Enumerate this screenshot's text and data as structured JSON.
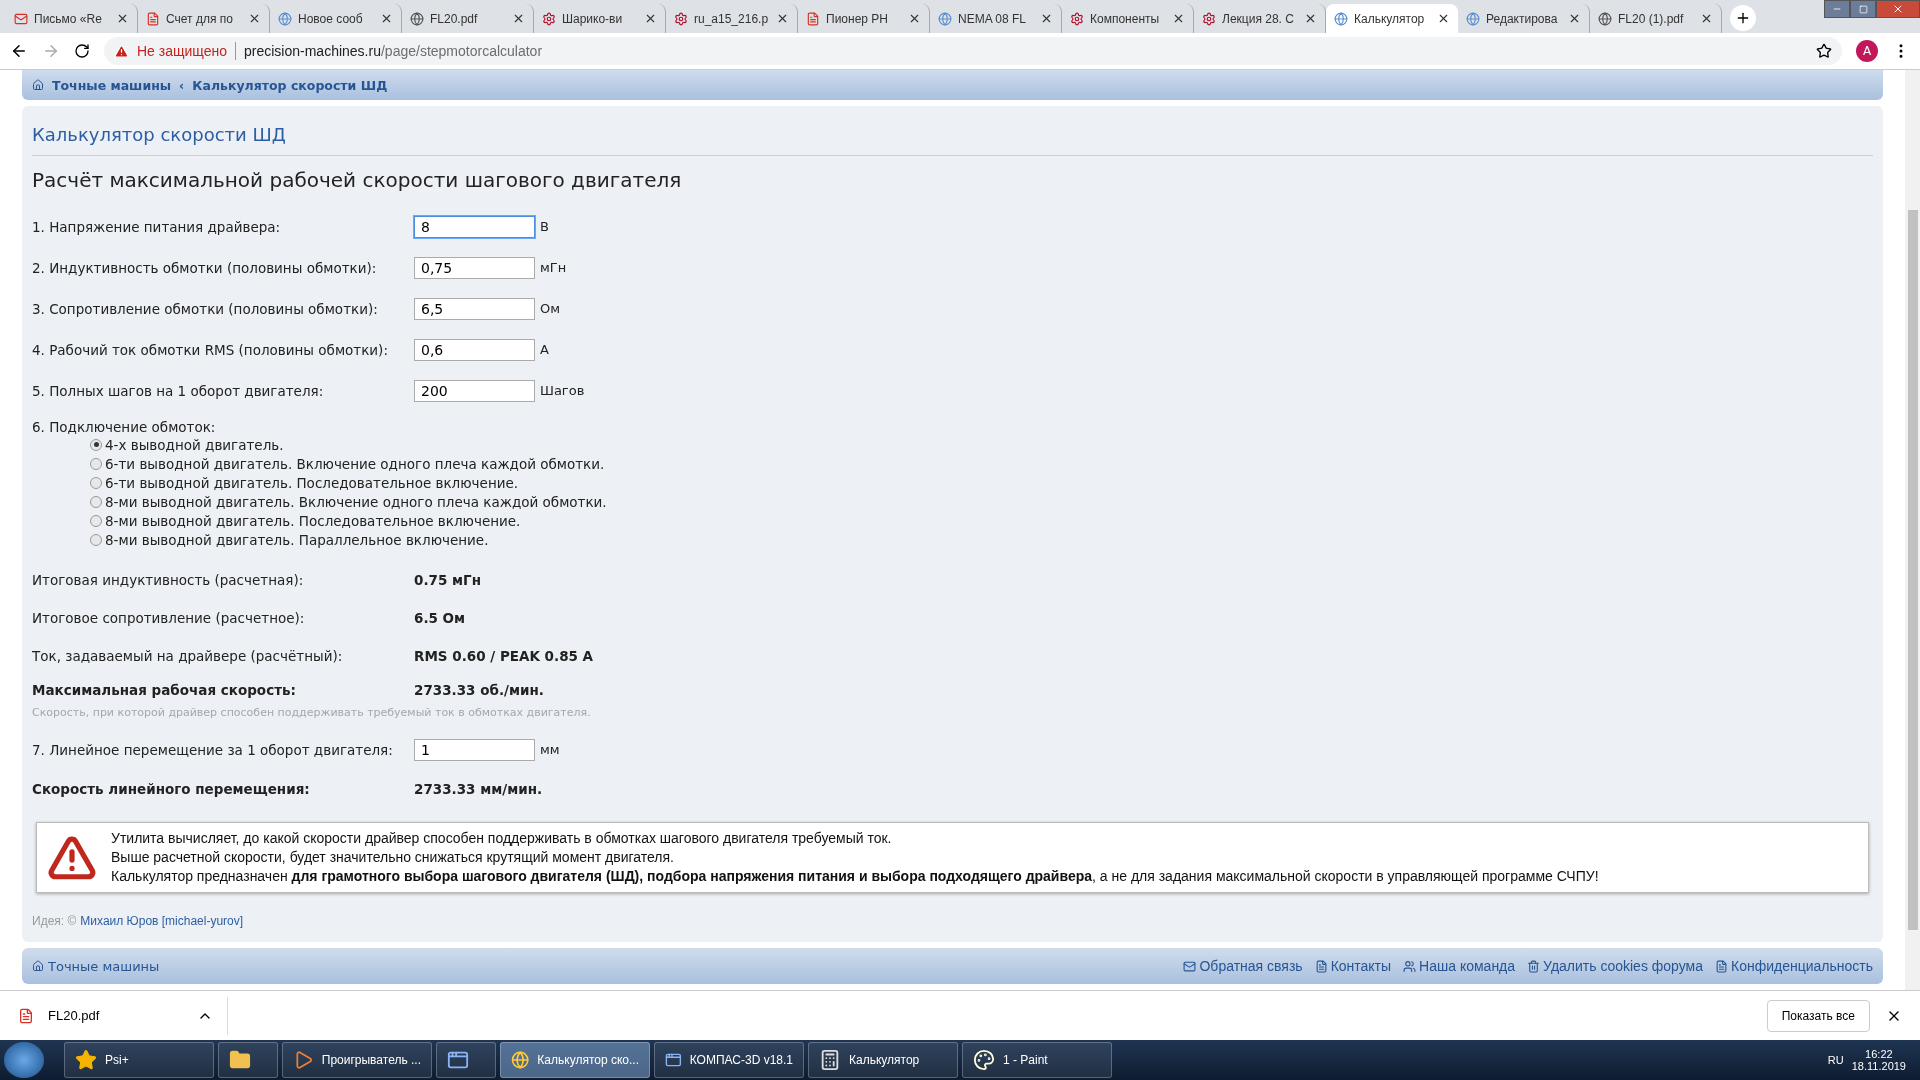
{
  "browser": {
    "tabs": [
      {
        "title": "Письмо «Re",
        "selected": false
      },
      {
        "title": "Счет для по",
        "selected": false
      },
      {
        "title": "Новое сооб",
        "selected": false
      },
      {
        "title": "FL20.pdf",
        "selected": false
      },
      {
        "title": "Шарико-ви",
        "selected": false
      },
      {
        "title": "ru_a15_216.p",
        "selected": false
      },
      {
        "title": "Пионер РН",
        "selected": false
      },
      {
        "title": "NEMA 08 FL",
        "selected": false
      },
      {
        "title": "Компоненты",
        "selected": false
      },
      {
        "title": "Лекция 28. С",
        "selected": false
      },
      {
        "title": "Калькулятор",
        "selected": true
      },
      {
        "title": "Редактирова",
        "selected": false
      },
      {
        "title": "FL20 (1).pdf",
        "selected": false
      }
    ],
    "security": "Не защищено",
    "host": "precision-machines.ru",
    "path": "/page/stepmotorcalculator",
    "profile": "A"
  },
  "breadcrumb": [
    "Точные машины",
    "Калькулятор скорости ШД"
  ],
  "breadcrumb_separator": "‹",
  "page_title": "Калькулятор скорости ШД",
  "heading": "Расчёт максимальной рабочей скорости шагового двигателя",
  "rows": [
    {
      "kind": "input",
      "label": "1. Напряжение питания драйвера:",
      "value": "8",
      "unit": "В",
      "focused": true
    },
    {
      "kind": "input",
      "label": "2. Индуктивность обмотки (половины обмотки):",
      "value": "0,75",
      "unit": "мГн",
      "focused": false
    },
    {
      "kind": "input",
      "label": "3. Сопротивление обмотки (половины обмотки):",
      "value": "6,5",
      "unit": "Ом",
      "focused": false
    },
    {
      "kind": "input",
      "label": "4. Рабочий ток обмотки RMS (половины обмотки):",
      "value": "0,6",
      "unit": "А",
      "focused": false
    },
    {
      "kind": "input",
      "label": "5. Полных шагов на 1 оборот двигателя:",
      "value": "200",
      "unit": "Шагов",
      "focused": false
    },
    {
      "kind": "radios",
      "label": "6. Подключение обмоток:",
      "options": [
        {
          "label": "4-х выводной двигатель.",
          "selected": true
        },
        {
          "label": "6-ти выводной двигатель. Включение одного плеча каждой обмотки.",
          "selected": false
        },
        {
          "label": "6-ти выводной двигатель. Последовательное включение.",
          "selected": false
        },
        {
          "label": "8-ми выводной двигатель. Включение одного плеча каждой обмотки.",
          "selected": false
        },
        {
          "label": "8-ми выводной двигатель. Последовательное включение.",
          "selected": false
        },
        {
          "label": "8-ми выводной двигатель. Параллельное включение.",
          "selected": false
        }
      ]
    },
    {
      "kind": "result",
      "label": "Итоговая индуктивность (расчетная):",
      "value": "0.75 мГн"
    },
    {
      "kind": "result",
      "label": "Итоговое сопротивление (расчетное):",
      "value": "6.5 Ом"
    },
    {
      "kind": "result",
      "label": "Ток, задаваемый на драйвере (расчётный):",
      "value": "RMS 0.60 / PEAK 0.85 A"
    },
    {
      "kind": "key_result",
      "label": "Максимальная рабочая скорость:",
      "value": "2733.33 об./мин.",
      "note": "Скорость, при которой драйвер способен поддерживать требуемый ток в обмотках двигателя."
    },
    {
      "kind": "input",
      "label": "7. Линейное перемещение за 1 оборот двигателя:",
      "value": "1",
      "unit": "мм",
      "focused": false
    },
    {
      "kind": "key_result",
      "label": "Скорость линейного перемещения:",
      "value": "2733.33 мм/мин."
    }
  ],
  "warning": [
    "Утилита вычисляет, до какой скорости драйвер способен поддерживать в обмотках шагового двигателя требуемый ток.",
    "Выше расчетной скорости, будет значительно снижаться крутящий момент двигателя.",
    "Калькулятор предназначен **для грамотного выбора шагового двигателя (ШД), подбора напряжения питания и выбора подходящего драйвера**, а не для задания максимальной скорости в управляющей программе СЧПУ!"
  ],
  "credit": {
    "prefix": "Идея: ©",
    "author": "Михаил Юров [michael-yurov]"
  },
  "footer": {
    "home": "Точные машины",
    "links": [
      "Обратная связь",
      "Контакты",
      "Наша команда",
      "Удалить cookies форума",
      "Конфиденциальность"
    ]
  },
  "downloads": {
    "file": "FL20.pdf",
    "show_all": "Показать все"
  },
  "taskbar": {
    "items": [
      {
        "label": "Psi+",
        "active": false
      },
      {
        "active": false
      },
      {
        "label": "Проигрыватель ...",
        "active": false
      },
      {
        "active": false
      },
      {
        "label": "Калькулятор ско...",
        "active": true
      },
      {
        "label": "КОМПАС-3D v18.1",
        "active": false
      },
      {
        "label": "Калькулятор",
        "active": false
      },
      {
        "label": "1 - Paint",
        "active": false
      }
    ],
    "lang": "RU",
    "time": "16:22",
    "date": "18.11.2019"
  }
}
